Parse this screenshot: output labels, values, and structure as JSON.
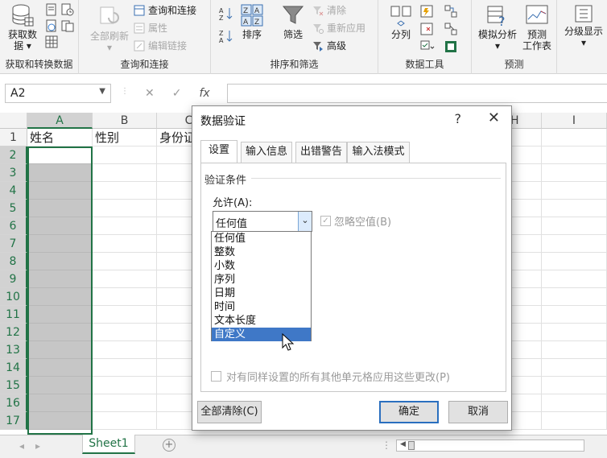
{
  "ribbon": {
    "get_data": {
      "label_line1": "获取数",
      "label_line2": "据"
    },
    "query_group": {
      "refresh_all": "全部刷新",
      "queries_connections": "查询和连接",
      "properties": "属性",
      "edit_links": "编辑链接"
    },
    "sort_group": {
      "sort": "排序",
      "filter": "筛选",
      "clear": "清除",
      "reapply": "重新应用",
      "advanced": "高级"
    },
    "tools_group": {
      "text_to_columns": "分列"
    },
    "forecast_group": {
      "what_if": "模拟分析",
      "forecast_sheet_line1": "预测",
      "forecast_sheet_line2": "工作表"
    },
    "outline_group": {
      "outline": "分级显示"
    },
    "group_labels": {
      "get_transform": "获取和转换数据",
      "queries_connections": "查询和连接",
      "sort_filter": "排序和筛选",
      "data_tools": "数据工具",
      "forecast": "预测"
    }
  },
  "formula_bar": {
    "name_box": "A2",
    "cancel": "✕",
    "enter": "✓",
    "fx": "fx",
    "value": ""
  },
  "grid": {
    "columns": [
      "A",
      "B",
      "C",
      "",
      "I"
    ],
    "col_H_partial": "H",
    "rows": [
      "1",
      "2",
      "3",
      "4",
      "5",
      "6",
      "7",
      "8",
      "9",
      "10",
      "11",
      "12",
      "13",
      "14",
      "15",
      "16",
      "17"
    ],
    "row1": {
      "A": "姓名",
      "B": "性别",
      "C": "身份证"
    }
  },
  "sheet_tabs": {
    "active": "Sheet1",
    "add": "+"
  },
  "dialog": {
    "title": "数据验证",
    "help": "?",
    "close": "✕",
    "tabs": [
      "设置",
      "输入信息",
      "出错警告",
      "输入法模式"
    ],
    "section_title": "验证条件",
    "allow_label": "允许(A):",
    "allow_value": "任何值",
    "ignore_blank": "忽略空值(B)",
    "options": [
      "任何值",
      "整数",
      "小数",
      "序列",
      "日期",
      "时间",
      "文本长度",
      "自定义"
    ],
    "highlighted_option": "自定义",
    "apply_all": "对有同样设置的所有其他单元格应用这些更改(P)",
    "clear_all": "全部清除(C)",
    "ok": "确定",
    "cancel": "取消"
  },
  "colors": {
    "excel_green": "#217346",
    "highlight_blue": "#3f78c7",
    "selection_shade": "#c6c6c6"
  }
}
